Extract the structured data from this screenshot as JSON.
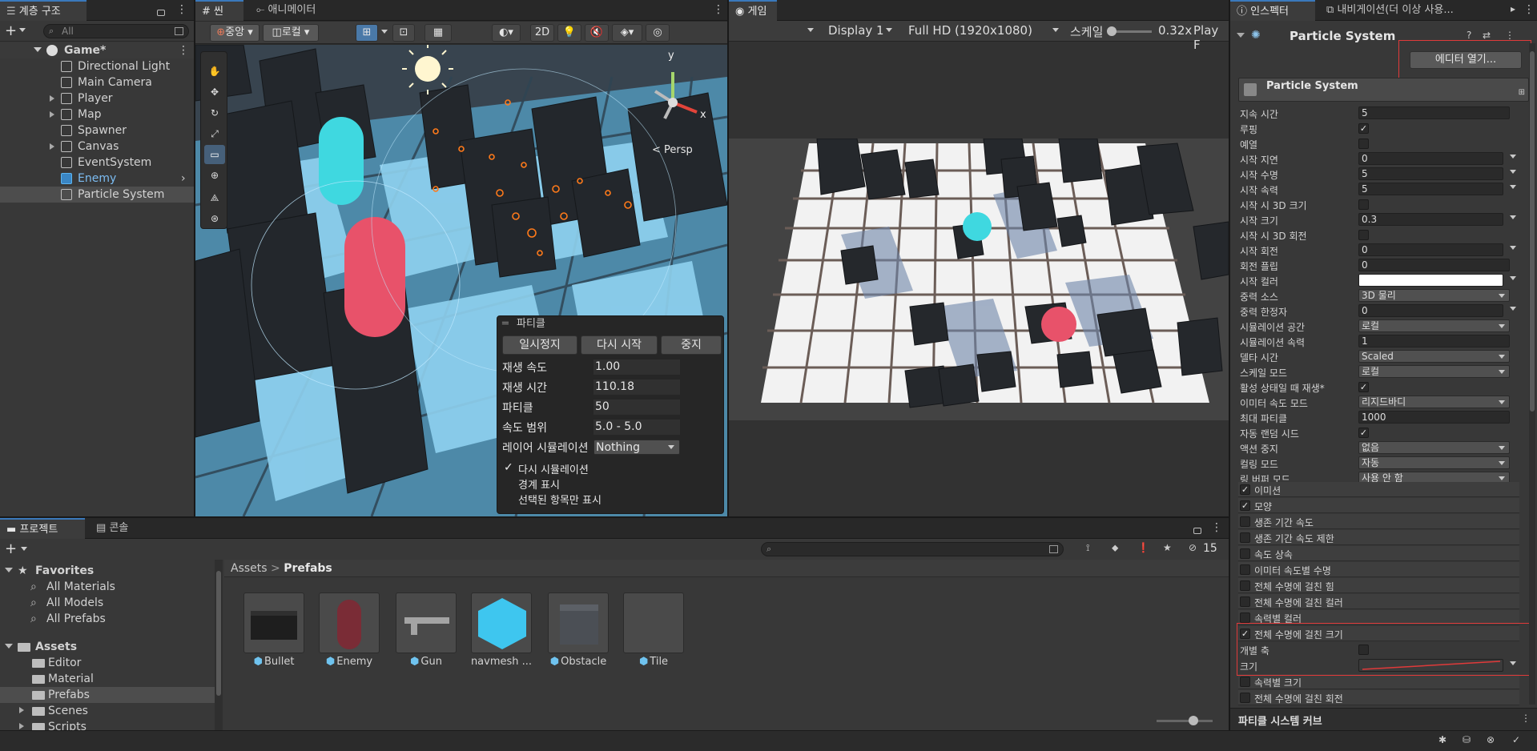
{
  "hierarchy": {
    "tab": "계층 구조",
    "search_placeholder": "All",
    "scene": "Game*",
    "items": [
      "Directional Light",
      "Main Camera",
      "Player",
      "Map",
      "Spawner",
      "Canvas",
      "EventSystem",
      "Enemy",
      "Particle System"
    ]
  },
  "scene": {
    "tab_scene": "씬",
    "tab_animator": "애니메이터",
    "pivot": "중앙",
    "space": "로컬",
    "mode_2d": "2D",
    "persp": "< Persp",
    "axis_x": "x",
    "axis_y": "y"
  },
  "particle_overlay": {
    "title": "파티클",
    "buttons": [
      "일시정지",
      "다시 시작",
      "중지"
    ],
    "rows": [
      {
        "label": "재생 속도",
        "value": "1.00"
      },
      {
        "label": "재생 시간",
        "value": "110.18"
      },
      {
        "label": "파티클",
        "value": "50"
      },
      {
        "label": "속도 범위",
        "value": "5.0 - 5.0"
      },
      {
        "label": "레이어 시뮬레이션",
        "value": "Nothing"
      }
    ],
    "checks": [
      {
        "label": "다시 시뮬레이션",
        "checked": true
      },
      {
        "label": "경계 표시",
        "checked": false
      },
      {
        "label": "선택된 항목만 표시",
        "checked": false
      }
    ]
  },
  "game": {
    "tab": "게임",
    "display": "Display 1",
    "resolution": "Full HD (1920x1080)",
    "scale_label": "스케일",
    "scale_value": "0.32x",
    "play": "Play F"
  },
  "inspector": {
    "tab": "인스펙터",
    "tab_nav": "내비게이션(더 이상 사용...",
    "component": "Particle System",
    "open_editor": "에디터 열기...",
    "module_header": "Particle System",
    "props": [
      {
        "label": "지속 시간",
        "value": "5",
        "type": "field"
      },
      {
        "label": "루핑",
        "value": "✓",
        "type": "check"
      },
      {
        "label": "예열",
        "value": "",
        "type": "check"
      },
      {
        "label": "시작 지연",
        "value": "0",
        "type": "fieldarr"
      },
      {
        "label": "시작 수명",
        "value": "5",
        "type": "fieldarr"
      },
      {
        "label": "시작 속력",
        "value": "5",
        "type": "fieldarr"
      },
      {
        "label": "시작 시 3D 크기",
        "value": "",
        "type": "check"
      },
      {
        "label": "시작 크기",
        "value": "0.3",
        "type": "fieldarr"
      },
      {
        "label": "시작 시 3D 회전",
        "value": "",
        "type": "check"
      },
      {
        "label": "시작 회전",
        "value": "0",
        "type": "fieldarr"
      },
      {
        "label": "회전 플립",
        "value": "0",
        "type": "field"
      },
      {
        "label": "시작 컬러",
        "value": "",
        "type": "color"
      },
      {
        "label": "중력 소스",
        "value": "3D 물리",
        "type": "drop"
      },
      {
        "label": "중력 한정자",
        "value": "0",
        "type": "fieldarr"
      },
      {
        "label": "시뮬레이션 공간",
        "value": "로컬",
        "type": "drop"
      },
      {
        "label": "시뮬레이션 속력",
        "value": "1",
        "type": "field"
      },
      {
        "label": "델타 시간",
        "value": "Scaled",
        "type": "drop"
      },
      {
        "label": "스케일 모드",
        "value": "로컬",
        "type": "drop"
      },
      {
        "label": "활성 상태일 때 재생*",
        "value": "✓",
        "type": "check"
      },
      {
        "label": "이미터 속도 모드",
        "value": "리지드바디",
        "type": "drop"
      },
      {
        "label": "최대 파티클",
        "value": "1000",
        "type": "field"
      },
      {
        "label": "자동 랜덤 시드",
        "value": "✓",
        "type": "check"
      },
      {
        "label": "액션 중지",
        "value": "없음",
        "type": "drop"
      },
      {
        "label": "컬링 모드",
        "value": "자동",
        "type": "drop"
      },
      {
        "label": "링 버퍼 모드",
        "value": "사용 안 함",
        "type": "drop"
      }
    ],
    "modules": [
      {
        "label": "이미션",
        "checked": true
      },
      {
        "label": "모양",
        "checked": true
      },
      {
        "label": "생존 기간 속도",
        "checked": false
      },
      {
        "label": "생존 기간 속도 제한",
        "checked": false
      },
      {
        "label": "속도 상속",
        "checked": false
      },
      {
        "label": "이미터 속도별 수명",
        "checked": false
      },
      {
        "label": "전체 수명에 걸친 힘",
        "checked": false
      },
      {
        "label": "전체 수명에 걸친 컬러",
        "checked": false
      },
      {
        "label": "속력별 컬러",
        "checked": false
      },
      {
        "label": "전체 수명에 걸친 크기",
        "checked": true
      },
      {
        "label": "속력별 크기",
        "checked": false
      },
      {
        "label": "전체 수명에 걸친 회전",
        "checked": false
      }
    ],
    "size_sub": [
      {
        "label": "개별 축"
      },
      {
        "label": "크기"
      }
    ],
    "footer": "파티클 시스템 커브",
    "highlight_color": "#e03a3a"
  },
  "project": {
    "tab_project": "프로젝트",
    "tab_console": "콘솔",
    "hidden_count": "15",
    "favorites": "Favorites",
    "fav_items": [
      "All Materials",
      "All Models",
      "All Prefabs"
    ],
    "assets": "Assets",
    "folders": [
      "Editor",
      "Material",
      "Prefabs",
      "Scenes",
      "Scripts"
    ],
    "breadcrumb_root": "Assets",
    "breadcrumb_current": "Prefabs",
    "prefabs": [
      "Bullet",
      "Enemy",
      "Gun",
      "navmesh ...",
      "Obstacle",
      "Tile"
    ]
  },
  "colors": {
    "accent": "#3a79bb",
    "selection": "#2c5d87",
    "panel": "#383838",
    "cyan": "#3ee6f0",
    "pink": "#e8526a"
  }
}
